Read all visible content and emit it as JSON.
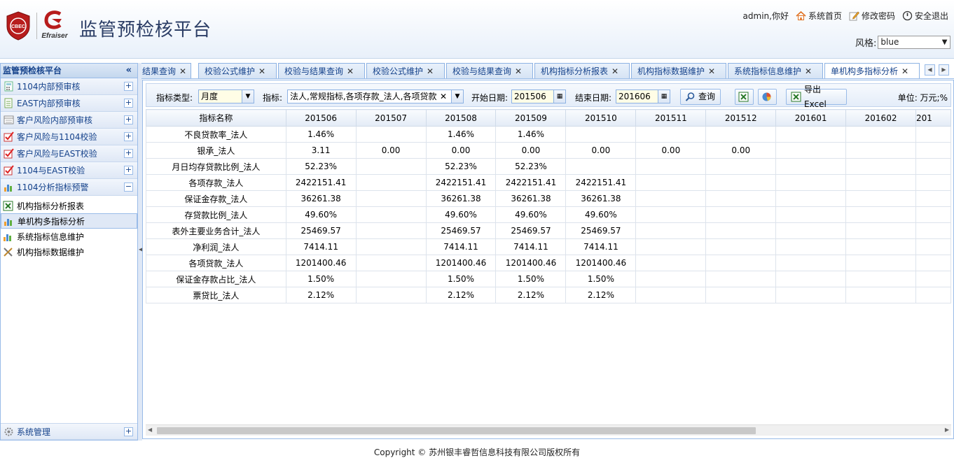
{
  "header": {
    "title": "监管预检核平台",
    "logo_text": "CBEC",
    "logo2_text": "Efraiser",
    "greeting": "admin,你好",
    "home_link": "系统首页",
    "password_link": "修改密码",
    "logout_link": "安全退出",
    "style_label": "风格:",
    "style_value": "blue"
  },
  "sidebar": {
    "title": "监管预检核平台",
    "collapse_symbol": "«",
    "groups": [
      {
        "label": "1104内部预审核",
        "icon": "calculator-icon",
        "state": "+"
      },
      {
        "label": "EAST内部预审核",
        "icon": "document-icon",
        "state": "+"
      },
      {
        "label": "客户风险内部预审核",
        "icon": "list-icon",
        "state": "+"
      },
      {
        "label": "客户风险与1104校验",
        "icon": "check-icon",
        "state": "+"
      },
      {
        "label": "客户风险与EAST校验",
        "icon": "check-icon",
        "state": "+"
      },
      {
        "label": "1104与EAST校验",
        "icon": "check-icon",
        "state": "+"
      },
      {
        "label": "1104分析指标预警",
        "icon": "bar-chart-icon",
        "state": "−"
      }
    ],
    "items": [
      {
        "label": "机构指标分析报表",
        "icon": "excel-icon"
      },
      {
        "label": "单机构多指标分析",
        "icon": "bar-chart-icon"
      },
      {
        "label": "系统指标信息维护",
        "icon": "bar-chart-icon"
      },
      {
        "label": "机构指标数据维护",
        "icon": "tools-icon"
      }
    ],
    "bottom": {
      "label": "系统管理",
      "icon": "gear-icon",
      "state": "+"
    }
  },
  "tabs": [
    {
      "label": "结果查询"
    },
    {
      "label": "校验公式维护"
    },
    {
      "label": "校验与结果查询"
    },
    {
      "label": "校验公式维护"
    },
    {
      "label": "校验与结果查询"
    },
    {
      "label": "机构指标分析报表"
    },
    {
      "label": "机构指标数据维护"
    },
    {
      "label": "系统指标信息维护"
    },
    {
      "label": "单机构多指标分析"
    }
  ],
  "toolbar": {
    "type_label": "指标类型:",
    "type_value": "月度",
    "index_label": "指标:",
    "index_value": "法人,常规指标,各项存款_法人,各项贷款",
    "start_label": "开始日期:",
    "start_value": "201506",
    "end_label": "结束日期:",
    "end_value": "201606",
    "query_label": "查询",
    "export_label": "导出Excel",
    "unit_label": "单位: 万元;%"
  },
  "table": {
    "columns": [
      "指标名称",
      "201506",
      "201507",
      "201508",
      "201509",
      "201510",
      "201511",
      "201512",
      "201601",
      "201602",
      "201"
    ],
    "rows": [
      [
        "不良贷款率_法人",
        "1.46%",
        "",
        "1.46%",
        "1.46%",
        "",
        "",
        "",
        "",
        "",
        ""
      ],
      [
        "银承_法人",
        "3.11",
        "0.00",
        "0.00",
        "0.00",
        "0.00",
        "0.00",
        "0.00",
        "",
        "",
        ""
      ],
      [
        "月日均存贷款比例_法人",
        "52.23%",
        "",
        "52.23%",
        "52.23%",
        "",
        "",
        "",
        "",
        "",
        ""
      ],
      [
        "各项存款_法人",
        "2422151.41",
        "",
        "2422151.41",
        "2422151.41",
        "2422151.41",
        "",
        "",
        "",
        "",
        ""
      ],
      [
        "保证金存款_法人",
        "36261.38",
        "",
        "36261.38",
        "36261.38",
        "36261.38",
        "",
        "",
        "",
        "",
        ""
      ],
      [
        "存贷款比例_法人",
        "49.60%",
        "",
        "49.60%",
        "49.60%",
        "49.60%",
        "",
        "",
        "",
        "",
        ""
      ],
      [
        "表外主要业务合计_法人",
        "25469.57",
        "",
        "25469.57",
        "25469.57",
        "25469.57",
        "",
        "",
        "",
        "",
        ""
      ],
      [
        "净利润_法人",
        "7414.11",
        "",
        "7414.11",
        "7414.11",
        "7414.11",
        "",
        "",
        "",
        "",
        ""
      ],
      [
        "各项贷款_法人",
        "1201400.46",
        "",
        "1201400.46",
        "1201400.46",
        "1201400.46",
        "",
        "",
        "",
        "",
        ""
      ],
      [
        "保证金存款占比_法人",
        "1.50%",
        "",
        "1.50%",
        "1.50%",
        "1.50%",
        "",
        "",
        "",
        "",
        ""
      ],
      [
        "票贷比_法人",
        "2.12%",
        "",
        "2.12%",
        "2.12%",
        "2.12%",
        "",
        "",
        "",
        "",
        ""
      ]
    ]
  },
  "footer": {
    "text": "Copyright © 苏州银丰睿哲信息科技有限公司版权所有"
  },
  "colors": {
    "accent": "#15428b",
    "border": "#99bbe8",
    "field_bg": "#fffde6"
  }
}
